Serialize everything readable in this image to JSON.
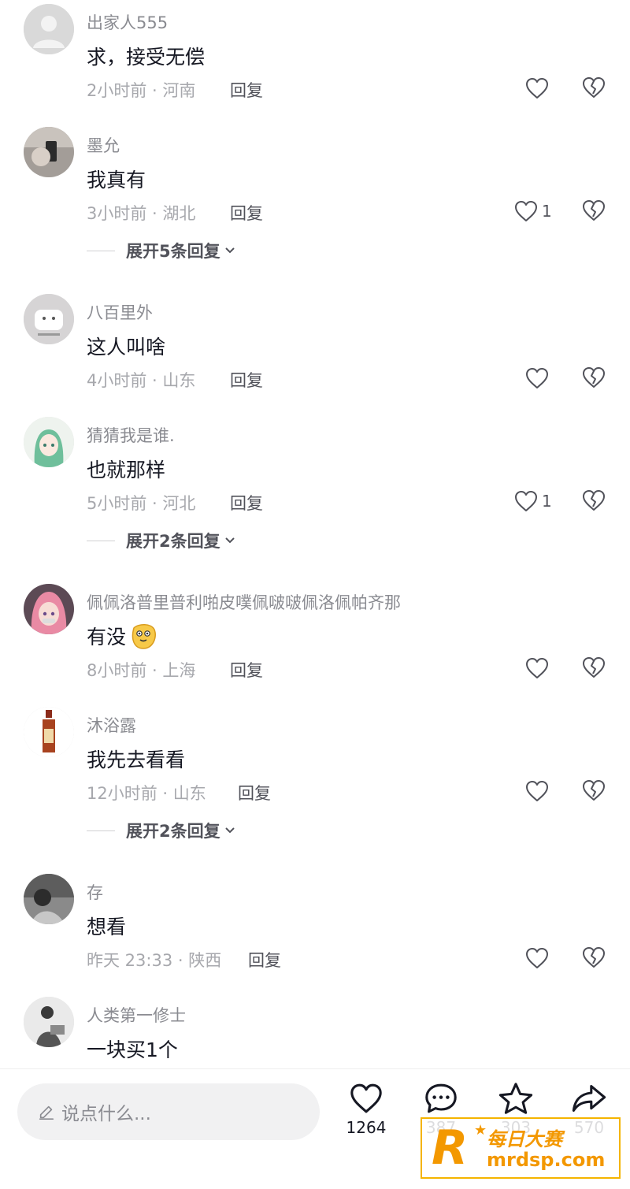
{
  "comments": [
    {
      "username": "出家人555",
      "text": "求，接受无偿",
      "time": "2小时前 · 河南",
      "reply": "回复",
      "likes": "",
      "expand": ""
    },
    {
      "username": "墨允",
      "text": "我真有",
      "time": "3小时前 · 湖北",
      "reply": "回复",
      "likes": "1",
      "expand": "展开5条回复"
    },
    {
      "username": "八百里外",
      "text": "这人叫啥",
      "time": "4小时前 · 山东",
      "reply": "回复",
      "likes": "",
      "expand": ""
    },
    {
      "username": "猜猜我是谁.",
      "text": "也就那样",
      "time": "5小时前 · 河北",
      "reply": "回复",
      "likes": "1",
      "expand": "展开2条回复"
    },
    {
      "username": "佩佩洛普里普利啪皮噗佩啵啵佩洛佩帕齐那",
      "text": "有没",
      "time": "8小时前 · 上海",
      "reply": "回复",
      "likes": "",
      "expand": ""
    },
    {
      "username": "沐浴露",
      "text": "我先去看看",
      "time": "12小时前 · 山东",
      "reply": "回复",
      "likes": "",
      "expand": "展开2条回复"
    },
    {
      "username": "存",
      "text": "想看",
      "time": "昨天 23:33 · 陕西",
      "reply": "回复",
      "likes": "",
      "expand": ""
    },
    {
      "username": "人类第一修士",
      "text": "一块买1个",
      "time": "",
      "reply": "",
      "likes": "",
      "expand": ""
    }
  ],
  "bottom_bar": {
    "input_placeholder": "说点什么...",
    "like_count": "1264",
    "comment_count": "387",
    "favorite_count": "303",
    "share_count": "570"
  },
  "watermark": {
    "logo_letter": "R",
    "title": "每日大赛",
    "url": "mrdsp.com"
  },
  "colors": {
    "primary_text": "#161823",
    "secondary_text": "#8a8b91",
    "watermark": "#f39800"
  },
  "icons": [
    "heart-icon",
    "broken-heart-icon",
    "chevron-down-icon",
    "pencil-icon",
    "comment-icon",
    "star-icon",
    "share-icon"
  ]
}
